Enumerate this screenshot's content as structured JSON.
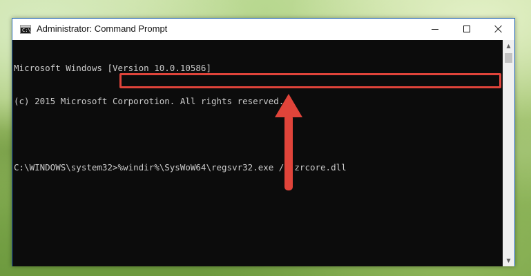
{
  "window": {
    "title": "Administrator: Command Prompt",
    "icon": "cmd-app-icon",
    "icon_text": "C:\\"
  },
  "controls": {
    "minimize": "minimize-icon",
    "maximize": "maximize-icon",
    "close": "close-icon"
  },
  "console": {
    "lines": [
      "Microsoft Windows [Version 10.0.10586]",
      "(c) 2015 Microsoft Corporotion. All rights reserved."
    ],
    "prompt": "C:\\WINDOWS\\system32>",
    "command": "%windir%\\SysWoW64\\regsvr32.exe /u zrcore.dll"
  },
  "annotation": {
    "highlight_color": "#e0443a",
    "arrow_color": "#e0443a",
    "arrow_direction": "up"
  },
  "scrollbar": {
    "up_icon": "scroll-up-arrow-icon",
    "down_icon": "scroll-down-arrow-icon"
  }
}
